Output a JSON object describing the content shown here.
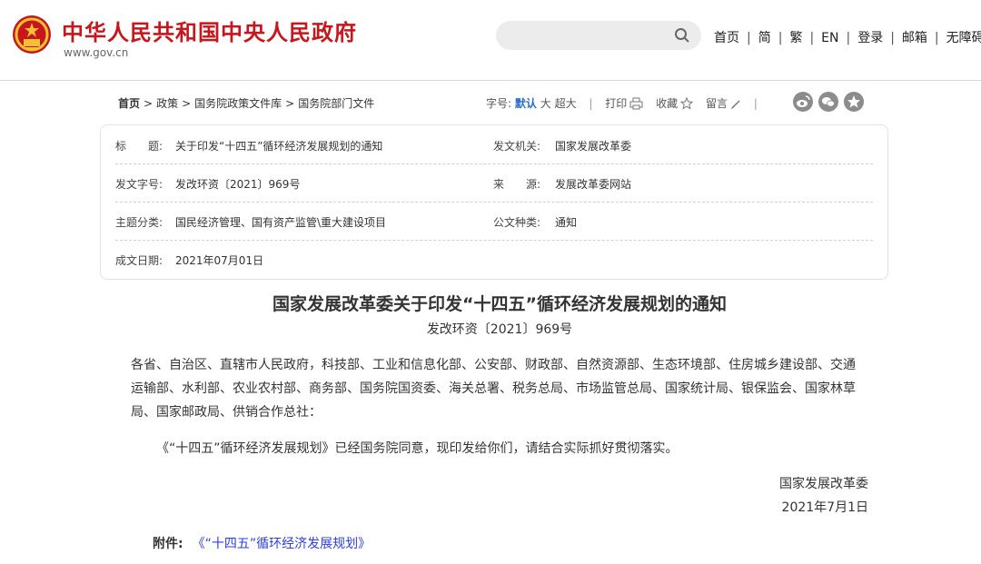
{
  "header": {
    "title": "中华人民共和国中央人民政府",
    "url": "www.gov.cn",
    "search_placeholder": "",
    "nav": [
      "首页",
      "简",
      "繁",
      "EN",
      "登录",
      "邮箱",
      "无障碍"
    ]
  },
  "breadcrumb": [
    "首页",
    "政策",
    "国务院政策文件库",
    "国务院部门文件"
  ],
  "tools": {
    "font_label": "字号:",
    "font_default": "默认",
    "font_large": "大",
    "font_xlarge": "超大",
    "print": "打印",
    "favorite": "收藏",
    "comment": "留言"
  },
  "meta": {
    "title_label": "标　　题:",
    "title_value": "关于印发“十四五”循环经济发展规划的通知",
    "issuer_label": "发文机关:",
    "issuer_value": "国家发展改革委",
    "docno_label": "发文字号:",
    "docno_value": "发改环资〔2021〕969号",
    "source_label": "来　　源:",
    "source_value": "发展改革委网站",
    "category_label": "主题分类:",
    "category_value": "国民经济管理、国有资产监管\\重大建设项目",
    "type_label": "公文种类:",
    "type_value": "通知",
    "date_label": "成文日期:",
    "date_value": "2021年07月01日"
  },
  "article": {
    "title": "国家发展改革委关于印发“十四五”循环经济发展规划的通知",
    "docno": "发改环资〔2021〕969号",
    "recipients": "各省、自治区、直辖市人民政府，科技部、工业和信息化部、公安部、财政部、自然资源部、生态环境部、住房城乡建设部、交通运输部、水利部、农业农村部、商务部、国务院国资委、海关总署、税务总局、市场监管总局、国家统计局、银保监会、国家林草局、国家邮政局、供销合作总社：",
    "body": "《“十四五”循环经济发展规划》已经国务院同意，现印发给你们，请结合实际抓好贯彻落实。",
    "signer": "国家发展改革委",
    "date": "2021年7月1日",
    "attachment_label": "附件:",
    "attachment_link": "《“十四五”循环经济发展规划》"
  },
  "colors": {
    "brand_red": "#c8161d",
    "link_blue": "#2a3fe0",
    "active_blue": "#2b6cd0"
  }
}
